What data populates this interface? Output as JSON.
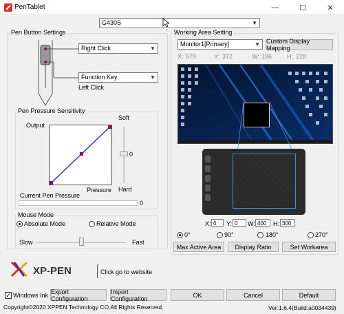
{
  "window": {
    "title": "PenTablet",
    "minimize": "—",
    "maximize": "☐",
    "close": "✕"
  },
  "device_select": {
    "value": "G430S"
  },
  "pen_button": {
    "legend": "Pen Button Settings",
    "upper_value": "Right Click",
    "lower_value": "Function Key",
    "lower_subtext": "Left Click"
  },
  "pressure": {
    "legend": "Pen Pressure Sensitivity",
    "output_label": "Output",
    "pressure_label": "Pressure",
    "soft_label": "Soft",
    "hard_label": "Hard",
    "slider_value": "0",
    "current_label": "Current Pen Pressure",
    "current_value": "0",
    "current_fill": 0.0
  },
  "mouse_mode": {
    "legend": "Mouse Mode",
    "absolute": "Absolute Mode",
    "relative": "Relative Mode",
    "slow": "Slow",
    "fast": "Fast",
    "speed": 0.5
  },
  "working_area": {
    "legend": "Working Area Setting",
    "monitor": "Monitor1[Primary]",
    "custom_mapping": "Custom Display Mapping",
    "x_label": "X:",
    "x_value": "579",
    "y_label": "Y:",
    "y_value": "372",
    "w_label": "W:",
    "w_value": "196",
    "h_label": "H:",
    "h_value": "228",
    "tx_label": "X:",
    "tx_value": "0",
    "ty_label": "Y:",
    "ty_value": "0",
    "tw_label": "W:",
    "tw_value": "400",
    "th_label": "H:",
    "th_value": "300",
    "rot0": "0°",
    "rot90": "90°",
    "rot180": "180°",
    "rot270": "270°",
    "max_area": "Max Active Area",
    "display_ratio": "Display Ratio",
    "set_workarea": "Set Workarea"
  },
  "brand": {
    "logo": "XP-PEN",
    "link": "Click go to website"
  },
  "bottom": {
    "windows_ink": "Windows Ink",
    "export": "Export Configuration",
    "import": "Import Configuration",
    "ok": "OK",
    "cancel": "Cancel",
    "default": "Default",
    "copyright": "Copyright©2020  XPPEN Technology CO.All Rights Reserved.",
    "version": "Ver:1.6.4(Build:a0034439)"
  },
  "colors": {
    "accent": "#0078d7",
    "curve": "#2b2bd8",
    "handle": "#a0005a"
  }
}
